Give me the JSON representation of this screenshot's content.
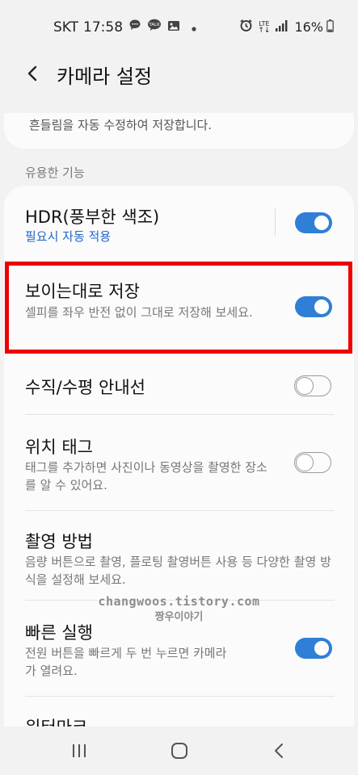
{
  "status_bar": {
    "carrier": "SKT",
    "time": "17:58",
    "notification_icons": [
      "chat-bubble-icon",
      "talk-bubble-icon",
      "gallery-icon",
      "dot-icon"
    ],
    "right_icons": [
      "alarm-icon",
      "lte-icon",
      "signal-icon"
    ],
    "lte_label": "LTE",
    "battery": "16%"
  },
  "header": {
    "title": "카메라 설정"
  },
  "top_card": {
    "text": "흔들림을 자동 수정하여 저장합니다."
  },
  "section": {
    "label": "유용한 기능"
  },
  "settings": [
    {
      "title": "HDR(풍부한 색조)",
      "subtitle": "필요시 자동 적용",
      "toggle": true
    },
    {
      "title": "보이는대로 저장",
      "subtitle": "셀피를 좌우 반전 없이 그대로 저장해 보세요.",
      "toggle": true
    },
    {
      "title": "수직/수평 안내선",
      "subtitle": "",
      "toggle": false
    },
    {
      "title": "위치 태그",
      "subtitle": "태그를 추가하면 사진이나 동영상을 촬영한 장소를 알 수 있어요.",
      "toggle": false
    },
    {
      "title": "촬영 방법",
      "subtitle": "음량 버튼으로 촬영, 플로팅 촬영버튼 사용 등 다양한 촬영 방식을 설정해 보세요."
    },
    {
      "title": "빠른 실행",
      "subtitle": "전원 버튼을 빠르게 두 번 누르면 카메라가 열려요.",
      "toggle": true
    },
    {
      "title": "워터마크"
    }
  ],
  "watermark": {
    "line1": "changwoos.tistory.com",
    "line2": "짱우이야기"
  },
  "nav_bar": {
    "icons": [
      "recent-apps-icon",
      "home-icon",
      "back-icon"
    ]
  },
  "colors": {
    "accent": "#2f7fd6",
    "highlight": "#ee0000",
    "subtitle_blue": "#2266c8"
  }
}
